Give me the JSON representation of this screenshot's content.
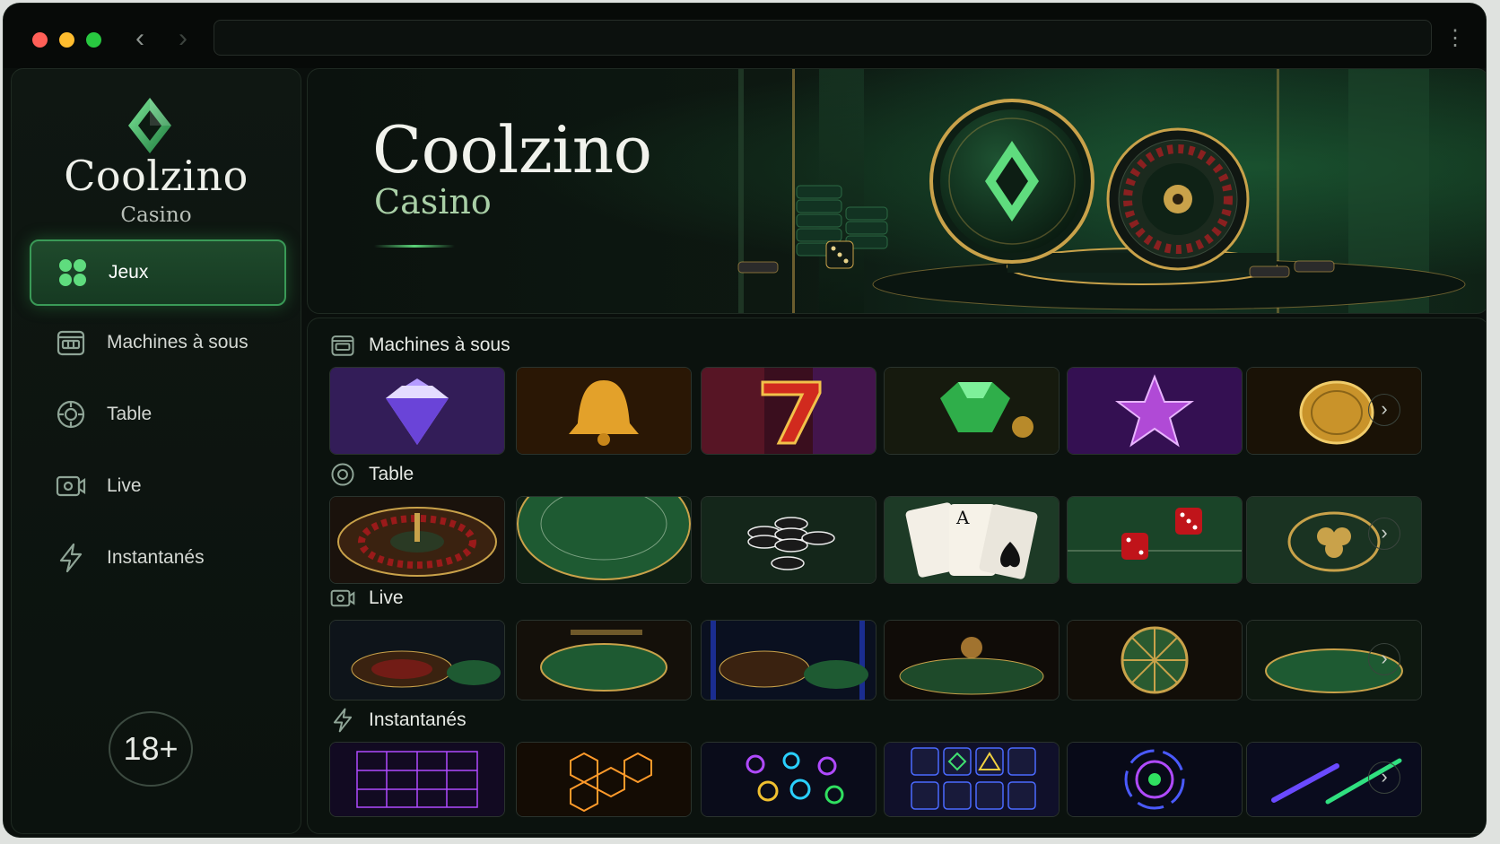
{
  "window": {
    "url": ""
  },
  "sidebar": {
    "logo_name": "Coolzino",
    "logo_sub": "Casino",
    "items": [
      {
        "label": "Jeux",
        "icon": "grid-icon",
        "active": true
      },
      {
        "label": "Machines à sous",
        "icon": "slot-machine-icon",
        "active": false
      },
      {
        "label": "Table",
        "icon": "chip-icon",
        "active": false
      },
      {
        "label": "Live",
        "icon": "camera-icon",
        "active": false
      },
      {
        "label": "Instantanés",
        "icon": "lightning-icon",
        "active": false
      }
    ],
    "age_badge": "18+"
  },
  "hero": {
    "title": "Coolzino",
    "subtitle": "Casino"
  },
  "sections": [
    {
      "label": "Machines à sous",
      "icon": "slot-machine-icon",
      "tiles": [
        "diamond",
        "bell",
        "seven",
        "emerald",
        "star",
        "gold-coin"
      ]
    },
    {
      "label": "Table",
      "icon": "chip-icon",
      "tiles": [
        "roulette",
        "blackjack-table",
        "poker-chips",
        "aces-cards",
        "craps-dice",
        "clover-table"
      ]
    },
    {
      "label": "Live",
      "icon": "camera-icon",
      "tiles": [
        "live-roulette-room",
        "live-blackjack-room",
        "live-roulette-neon",
        "live-baccarat-room",
        "live-wheel",
        "live-table-room"
      ]
    },
    {
      "label": "Instantanés",
      "icon": "lightning-icon",
      "tiles": [
        "neon-grid",
        "hexagons",
        "neon-orbs",
        "symbol-grid",
        "neon-target",
        "neon-streaks"
      ]
    }
  ],
  "colors": {
    "accent": "#3a9a57",
    "background": "#0a0f0c",
    "gold": "#c9a24a"
  }
}
